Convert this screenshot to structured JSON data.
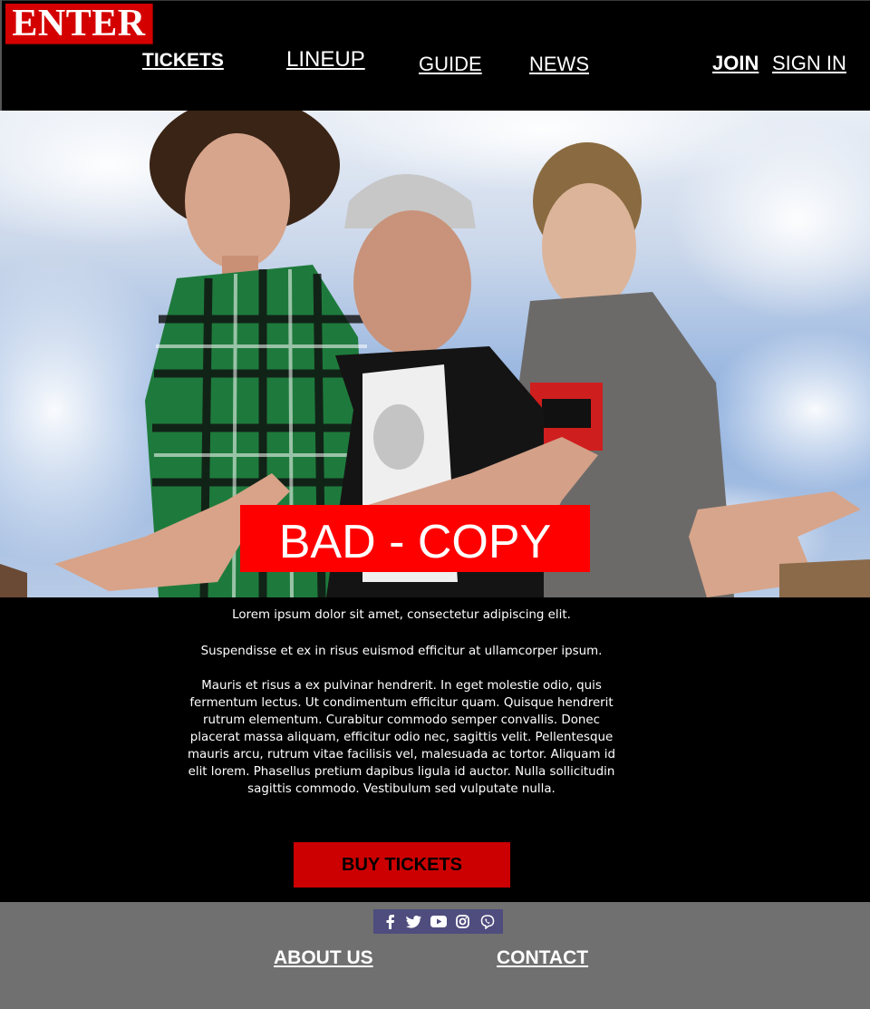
{
  "header": {
    "logo": "ENTER",
    "nav": {
      "tickets": "TICKETS",
      "lineup": "LINEUP",
      "guide": "GUIDE",
      "news": "NEWS"
    },
    "account": {
      "join": "JOIN",
      "sign_in": "SIGN IN"
    }
  },
  "hero": {
    "title": "BAD - COPY"
  },
  "content": {
    "paragraphs": [
      "Lorem ipsum dolor sit amet, consectetur adipiscing elit.",
      "Suspendisse et ex in risus euismod efficitur at ullamcorper ipsum.",
      "Mauris et risus a ex pulvinar hendrerit. In eget molestie odio, quis fermentum lectus. Ut condimentum efficitur quam. Quisque hendrerit rutrum elementum. Curabitur commodo semper convallis. Donec placerat massa aliquam, efficitur odio nec, sagittis velit. Pellentesque mauris arcu, rutrum vitae facilisis vel, malesuada ac tortor. Aliquam id elit lorem. Phasellus pretium dapibus ligula id auctor. Nulla sollicitudin sagittis commodo. Vestibulum sed vulputate nulla."
    ],
    "buy_button": "BUY TICKETS"
  },
  "footer": {
    "social_icons": [
      "facebook-icon",
      "twitter-icon",
      "youtube-icon",
      "instagram-icon",
      "viber-icon"
    ],
    "about": "ABOUT US",
    "contact": "CONTACT"
  },
  "colors": {
    "brand_red": "#d40000",
    "title_red": "#ff0000",
    "button_red": "#cc0000",
    "footer_gray": "#707070",
    "social_bar": "#4f4c7e"
  }
}
